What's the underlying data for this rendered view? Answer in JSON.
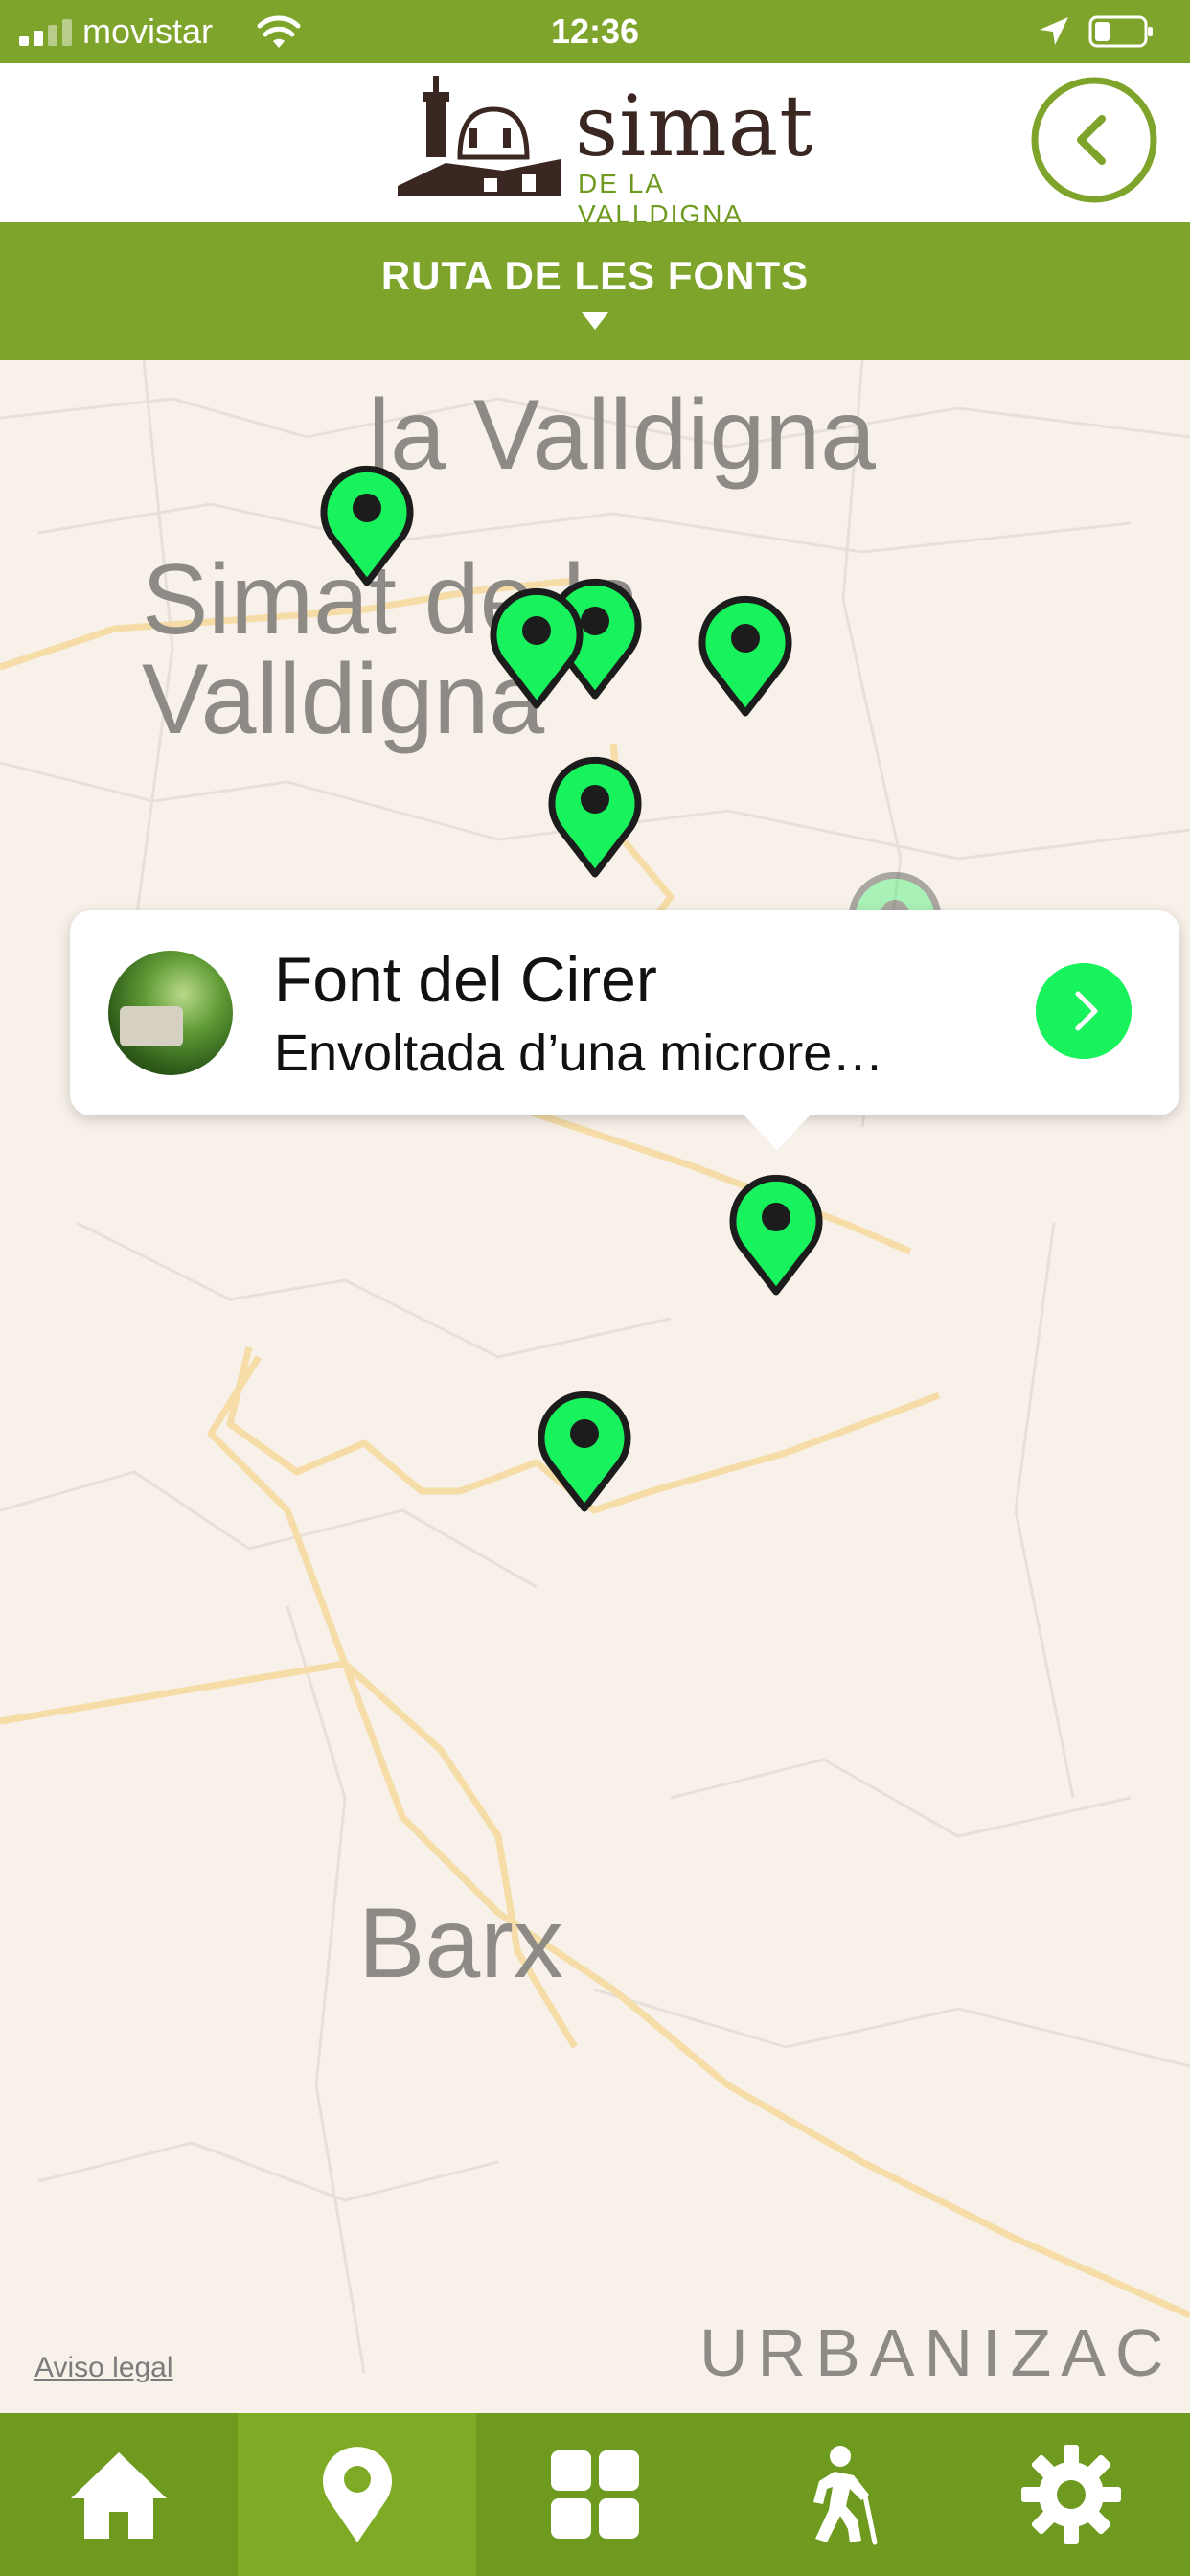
{
  "status_bar": {
    "carrier": "movistar",
    "time": "12:36"
  },
  "header": {
    "logo_name": "simat",
    "logo_tagline": "DE LA VALLDIGNA",
    "back_icon": "chevron-left-icon"
  },
  "route": {
    "title": "RUTA DE LES FONTS",
    "dropdown_icon": "caret-down-icon"
  },
  "map": {
    "labels": {
      "valldigna": "la Valldigna",
      "simat": "Simat de la Valldigna",
      "barx": "Barx",
      "urbanization": "URBANIZAC"
    },
    "legal": "Aviso legal",
    "pin_count": 10
  },
  "callout": {
    "title": "Font del Cirer",
    "description": "Envoltada d’una microre…",
    "go_icon": "chevron-right-icon"
  },
  "tab_bar": {
    "items": [
      {
        "icon": "home-icon",
        "active": false
      },
      {
        "icon": "map-pin-icon",
        "active": true
      },
      {
        "icon": "grid-icon",
        "active": false
      },
      {
        "icon": "hiker-icon",
        "active": false
      },
      {
        "icon": "gear-icon",
        "active": false
      }
    ]
  },
  "colors": {
    "brand_green": "#7ea42b",
    "pin_green": "#18f25c",
    "map_bg": "#f7f1e9"
  }
}
